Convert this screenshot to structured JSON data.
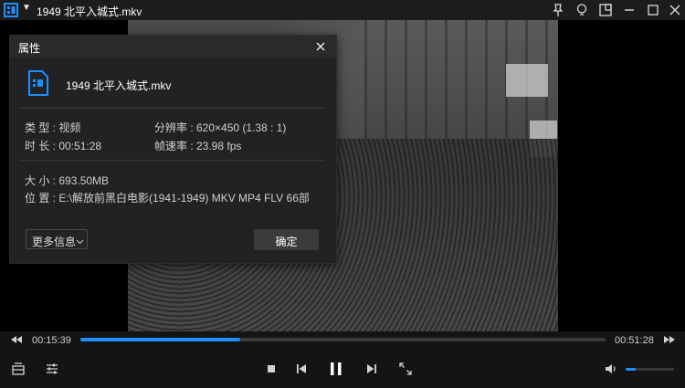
{
  "window": {
    "file_title": "1949 北平入城式.mkv"
  },
  "dialog": {
    "title": "属性",
    "filename": "1949 北平入城式.mkv",
    "type": "类 型 : 视频",
    "duration": "时 长 : 00:51:28",
    "resolution": "分辨率 : 620×450 (1.38 : 1)",
    "framerate": "帧速率 : 23.98 fps",
    "size": "大 小 : 693.50MB",
    "location": "位 置 : E:\\解放前黑白电影(1941-1949) MKV MP4 FLV 66部",
    "more_info_label": "更多信息",
    "ok_label": "确定"
  },
  "player": {
    "current_time": "00:15:39",
    "total_time": "00:51:28",
    "progress_fraction": 0.304,
    "volume_fraction": 0.2
  },
  "colors": {
    "accent": "#1e8fff",
    "background": "#0f0f0f",
    "dialog_bg": "#222224"
  },
  "icons": {
    "app_logo": "player-logo-icon",
    "titlebar": [
      "pin-icon",
      "lightbulb-icon",
      "miniplayer-icon",
      "minimize-icon",
      "maximize-icon",
      "close-icon"
    ],
    "controls_left": [
      "playlist-icon",
      "settings-sliders-icon"
    ],
    "controls_center": [
      "stop-icon",
      "previous-icon",
      "pause-icon",
      "next-icon",
      "fullscreen-icon"
    ],
    "controls_right": [
      "volume-icon"
    ]
  }
}
